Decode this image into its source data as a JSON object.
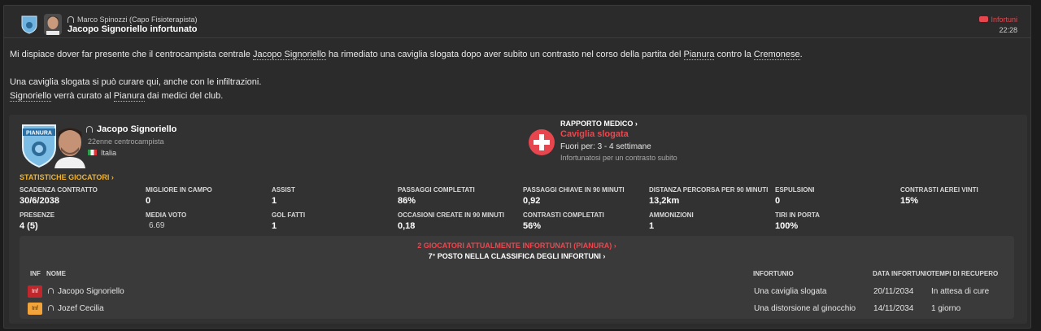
{
  "header": {
    "sender": "Marco Spinozzi  (Capo Fisioterapista)",
    "subject": "Jacopo Signoriello infortunato",
    "category": "Infortuni",
    "time": "22:28"
  },
  "message": {
    "l1_a": "Mi dispiace dover far presente che il centrocampista centrale ",
    "l1_player": "Jacopo Signoriello",
    "l1_b": " ha rimediato una caviglia slogata dopo aver subito un contrasto nel corso della partita del ",
    "l1_club": "Pianura",
    "l1_c": " contro la ",
    "l1_opp": "Cremonese",
    "l1_d": ".",
    "l2": "Una caviglia slogata si può curare qui, anche con le infiltrazioni.",
    "l3_player": "Signoriello",
    "l3_a": " verrà curato al ",
    "l3_club": "Pianura",
    "l3_b": " dai medici del club."
  },
  "player": {
    "club_crest_text": "PIANURA",
    "name": "Jacopo Signoriello",
    "description": "22enne centrocampista",
    "nationality": "Italia"
  },
  "medical": {
    "link": "RAPPORTO MEDICO ›",
    "injury": "Caviglia slogata",
    "out_for": "Fuori per: 3 - 4 settimane",
    "cause": "Infortunatosi per un contrasto subito"
  },
  "stats": {
    "link": "STATISTICHE GIOCATORI ›",
    "items": [
      {
        "label": "SCADENZA CONTRATTO",
        "value": "30/6/2038"
      },
      {
        "label": "MIGLIORE IN CAMPO",
        "value": "0"
      },
      {
        "label": "ASSIST",
        "value": "1"
      },
      {
        "label": "PASSAGGI COMPLETATI",
        "value": "86%"
      },
      {
        "label": "PASSAGGI CHIAVE IN 90 MINUTI",
        "value": "0,92"
      },
      {
        "label": "DISTANZA PERCORSA PER 90 MINUTI",
        "value": "13,2km"
      },
      {
        "label": "ESPULSIONI",
        "value": "0"
      },
      {
        "label": "CONTRASTI AEREI VINTI",
        "value": "15%"
      },
      {
        "label": "PRESENZE",
        "value": "4 (5)"
      },
      {
        "label": "MEDIA VOTO",
        "value": "6.69"
      },
      {
        "label": "GOL FATTI",
        "value": "1"
      },
      {
        "label": "OCCASIONI CREATE IN 90 MINUTI",
        "value": "0,18"
      },
      {
        "label": "CONTRASTI COMPLETATI",
        "value": "56%"
      },
      {
        "label": "AMMONIZIONI",
        "value": "1"
      },
      {
        "label": "TIRI IN PORTA",
        "value": "100%"
      }
    ]
  },
  "injured": {
    "title": "2 GIOCATORI ATTUALMENTE INFORTUNATI (PIANURA) ›",
    "subtitle": "7° POSTO NELLA CLASSIFICA DEGLI INFORTUNI ›",
    "columns": {
      "inf": "INF",
      "name": "NOME",
      "injury": "INFORTUNIO",
      "date": "DATA INFORTUNIO",
      "recovery": "TEMPI DI RECUPERO"
    },
    "rows": [
      {
        "badge": "Inf",
        "badge_bg": "#c0272d",
        "badge_fg": "#ffffff",
        "name": "Jacopo Signoriello",
        "injury": "Una caviglia slogata",
        "date": "20/11/2034",
        "recovery": "In attesa di cure"
      },
      {
        "badge": "Inf",
        "badge_bg": "#f2a43a",
        "badge_fg": "#3a2a10",
        "name": "Jozef Cecilia",
        "injury": "Una distorsione al ginocchio",
        "date": "14/11/2034",
        "recovery": "1 giorno"
      }
    ]
  },
  "colors": {
    "accent_red": "#e8464e",
    "accent_yellow": "#f1b22a"
  }
}
